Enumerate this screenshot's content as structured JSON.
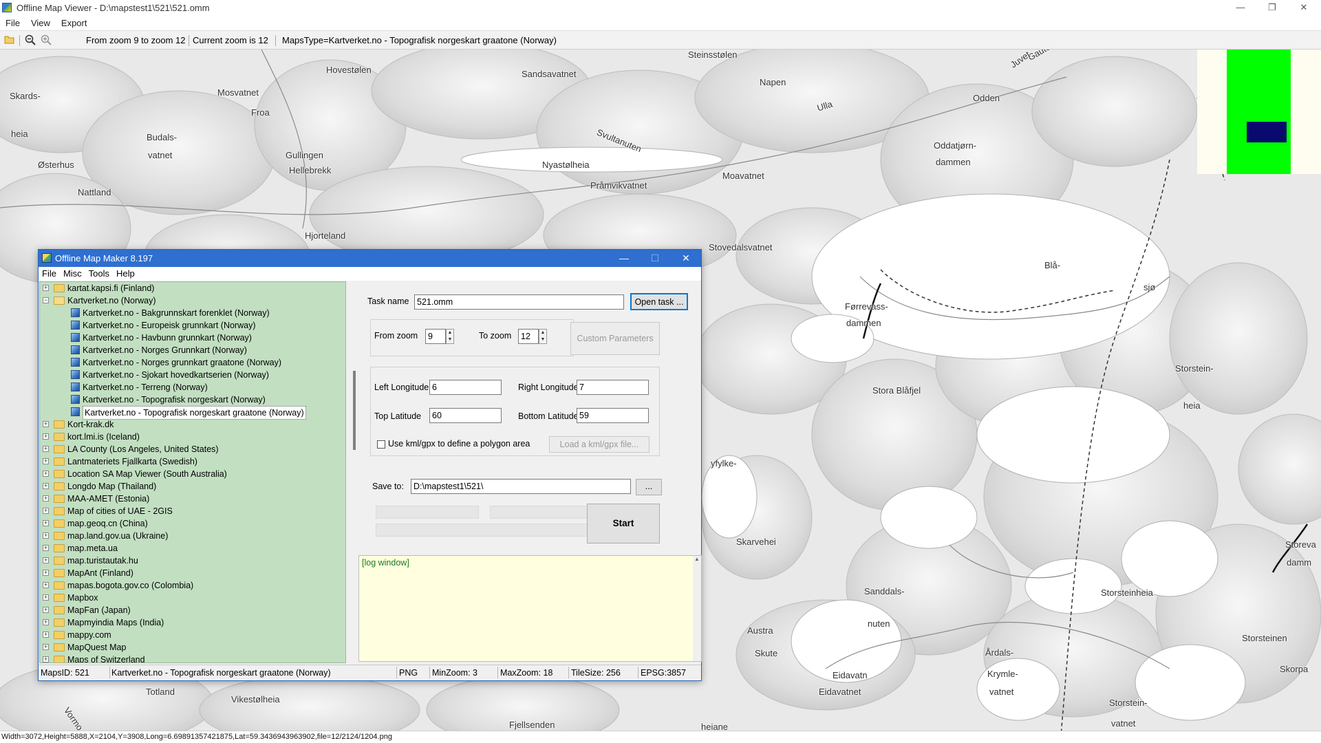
{
  "window": {
    "title": "Offline Map Viewer - D:\\mapstest1\\521\\521.omm",
    "minimize": "—",
    "maximize": "❐",
    "close": "✕"
  },
  "menu": {
    "file": "File",
    "view": "View",
    "export": "Export"
  },
  "toolbar": {
    "open_icon": "folder-open-icon",
    "zoom_out_icon": "zoom-out-icon",
    "zoom_in_icon": "zoom-in-icon",
    "zoom_range": "From zoom 9 to zoom 12",
    "current_zoom": "Current zoom is 12",
    "maps_type": "MapsType=Kartverket.no - Topografisk norgeskart graatone (Norway)"
  },
  "map_labels": [
    {
      "id": "skards",
      "text": "Skards-"
    },
    {
      "id": "heia1",
      "text": "heia"
    },
    {
      "id": "mosvatnet",
      "text": "Mosvatnet"
    },
    {
      "id": "froa",
      "text": "Froa"
    },
    {
      "id": "hovestolen",
      "text": "Hovestølen"
    },
    {
      "id": "sandsavatnet",
      "text": "Sandsavatnet"
    },
    {
      "id": "steinsstolen",
      "text": "Steinsstølen"
    },
    {
      "id": "napen",
      "text": "Napen"
    },
    {
      "id": "gaute",
      "text": "Gaute"
    },
    {
      "id": "juvet",
      "text": "Juvet"
    },
    {
      "id": "odden",
      "text": "Odden"
    },
    {
      "id": "ulla",
      "text": "Ulla"
    },
    {
      "id": "budals",
      "text": "Budals-"
    },
    {
      "id": "vatnet1",
      "text": "vatnet"
    },
    {
      "id": "gullingen",
      "text": "Gullingen"
    },
    {
      "id": "hellebrekk",
      "text": "Hellebrekk"
    },
    {
      "id": "osterhus",
      "text": "Østerhus"
    },
    {
      "id": "sviltanuten",
      "text": "Svultanuten"
    },
    {
      "id": "nyastolheia",
      "text": "Nyastølheia"
    },
    {
      "id": "oddatjorn",
      "text": "Oddatjørn-"
    },
    {
      "id": "dammen1",
      "text": "dammen"
    },
    {
      "id": "moavatnet",
      "text": "Moavatnet"
    },
    {
      "id": "pramvikvatnet",
      "text": "Pråmvikvatnet"
    },
    {
      "id": "nattland",
      "text": "Nattland"
    },
    {
      "id": "hjorteland",
      "text": "Hjorteland"
    },
    {
      "id": "stovedalsvatnet",
      "text": "Stovedalsvatnet"
    },
    {
      "id": "bla",
      "text": "Blå-"
    },
    {
      "id": "sjo",
      "text": "sjø"
    },
    {
      "id": "forrevass",
      "text": "Førrevass-"
    },
    {
      "id": "dammen2",
      "text": "dammen"
    },
    {
      "id": "storstein1",
      "text": "Storstein-"
    },
    {
      "id": "heia2",
      "text": "heia"
    },
    {
      "id": "stora_blafjel",
      "text": "Stora Blåfjel"
    },
    {
      "id": "fylke",
      "text": "yfylke-"
    },
    {
      "id": "skarvehei",
      "text": "Skarvehei"
    },
    {
      "id": "sanddals",
      "text": "Sanddals-"
    },
    {
      "id": "nuten",
      "text": "nuten"
    },
    {
      "id": "storsteinheia",
      "text": "Storsteinheia"
    },
    {
      "id": "storeva",
      "text": "Storeva"
    },
    {
      "id": "damm",
      "text": "damm"
    },
    {
      "id": "austra",
      "text": "Austra"
    },
    {
      "id": "skute",
      "text": "Skute"
    },
    {
      "id": "ardals",
      "text": "Årdals-"
    },
    {
      "id": "krymle",
      "text": "Krymle-"
    },
    {
      "id": "vatnet2",
      "text": "vatnet"
    },
    {
      "id": "storsteinen",
      "text": "Storsteinen"
    },
    {
      "id": "eidavatn",
      "text": "Eidavatn"
    },
    {
      "id": "eidavatnet",
      "text": "Eidavatnet"
    },
    {
      "id": "skorpa",
      "text": "Skorpa"
    },
    {
      "id": "storstein2",
      "text": "Storstein-"
    },
    {
      "id": "vatnet3",
      "text": "vatnet"
    },
    {
      "id": "totland",
      "text": "Totland"
    },
    {
      "id": "vikestolheia",
      "text": "Vikestølheia"
    },
    {
      "id": "vormo",
      "text": "Vormo"
    },
    {
      "id": "fjellsenden",
      "text": "Fjellsenden"
    },
    {
      "id": "heiane",
      "text": "heiane"
    }
  ],
  "status_bar": "Width=3072,Height=5888,X=2104,Y=3908,Long=6.69891357421875,Lat=59.3436943963902,file=12/2124/1204.png",
  "dialog": {
    "title": "Offline Map Maker 8.197",
    "minimize": "—",
    "maximize": "☐",
    "close": "✕",
    "menu": {
      "file": "File",
      "misc": "Misc",
      "tools": "Tools",
      "help": "Help"
    },
    "tree": [
      {
        "level": 0,
        "type": "folder",
        "expander": "+",
        "label": "kartat.kapsi.fi (Finland)"
      },
      {
        "level": 0,
        "type": "folder-open",
        "expander": "−",
        "label": "Kartverket.no (Norway)"
      },
      {
        "level": 1,
        "type": "map",
        "label": "Kartverket.no - Bakgrunnskart forenklet (Norway)"
      },
      {
        "level": 1,
        "type": "map",
        "label": "Kartverket.no - Europeisk grunnkart (Norway)"
      },
      {
        "level": 1,
        "type": "map",
        "label": "Kartverket.no - Havbunn grunnkart (Norway)"
      },
      {
        "level": 1,
        "type": "map",
        "label": "Kartverket.no - Norges Grunnkart (Norway)"
      },
      {
        "level": 1,
        "type": "map",
        "label": "Kartverket.no - Norges grunnkart graatone (Norway)"
      },
      {
        "level": 1,
        "type": "map",
        "label": "Kartverket.no - Sjokart hovedkartserien (Norway)"
      },
      {
        "level": 1,
        "type": "map",
        "label": "Kartverket.no - Terreng (Norway)"
      },
      {
        "level": 1,
        "type": "map",
        "label": "Kartverket.no - Topografisk norgeskart (Norway)"
      },
      {
        "level": 1,
        "type": "map",
        "label": "Kartverket.no - Topografisk norgeskart graatone (Norway)",
        "selected": true
      },
      {
        "level": 0,
        "type": "folder",
        "expander": "+",
        "label": "Kort-krak.dk"
      },
      {
        "level": 0,
        "type": "folder",
        "expander": "+",
        "label": "kort.lmi.is (Iceland)"
      },
      {
        "level": 0,
        "type": "folder",
        "expander": "+",
        "label": "LA County (Los Angeles, United States)"
      },
      {
        "level": 0,
        "type": "folder",
        "expander": "+",
        "label": "Lantmateriets Fjallkarta (Swedish)"
      },
      {
        "level": 0,
        "type": "folder",
        "expander": "+",
        "label": "Location SA Map Viewer (South Australia)"
      },
      {
        "level": 0,
        "type": "folder",
        "expander": "+",
        "label": "Longdo Map (Thailand)"
      },
      {
        "level": 0,
        "type": "folder",
        "expander": "+",
        "label": "MAA-AMET (Estonia)"
      },
      {
        "level": 0,
        "type": "folder",
        "expander": "+",
        "label": "Map of cities of UAE - 2GIS"
      },
      {
        "level": 0,
        "type": "folder",
        "expander": "+",
        "label": "map.geoq.cn (China)"
      },
      {
        "level": 0,
        "type": "folder",
        "expander": "+",
        "label": "map.land.gov.ua (Ukraine)"
      },
      {
        "level": 0,
        "type": "folder",
        "expander": "+",
        "label": "map.meta.ua"
      },
      {
        "level": 0,
        "type": "folder",
        "expander": "+",
        "label": "map.turistautak.hu"
      },
      {
        "level": 0,
        "type": "folder",
        "expander": "+",
        "label": "MapAnt (Finland)"
      },
      {
        "level": 0,
        "type": "folder",
        "expander": "+",
        "label": "mapas.bogota.gov.co (Colombia)"
      },
      {
        "level": 0,
        "type": "folder",
        "expander": "+",
        "label": "Mapbox"
      },
      {
        "level": 0,
        "type": "folder",
        "expander": "+",
        "label": "MapFan (Japan)"
      },
      {
        "level": 0,
        "type": "folder",
        "expander": "+",
        "label": "Mapmyindia Maps (India)"
      },
      {
        "level": 0,
        "type": "folder",
        "expander": "+",
        "label": "mappy.com"
      },
      {
        "level": 0,
        "type": "folder",
        "expander": "+",
        "label": "MapQuest Map"
      },
      {
        "level": 0,
        "type": "folder",
        "expander": "+",
        "label": "Maps of Switzerland"
      }
    ],
    "task_name_label": "Task name",
    "task_name_value": "521.omm",
    "open_task_button": "Open task ...",
    "from_zoom_label": "From zoom",
    "from_zoom_value": "9",
    "to_zoom_label": "To zoom",
    "to_zoom_value": "12",
    "custom_params_button": "Custom Parameters",
    "left_longitude_label": "Left Longitude",
    "left_longitude_value": "6",
    "right_longitude_label": "Right Longitude",
    "right_longitude_value": "7",
    "top_latitude_label": "Top Latitude",
    "top_latitude_value": "60",
    "bottom_latitude_label": "Bottom Latitude",
    "bottom_latitude_value": "59",
    "use_kml_label": "Use kml/gpx to define a polygon area",
    "use_kml_checked": false,
    "load_kml_button": "Load a kml/gpx file...",
    "save_to_label": "Save to:",
    "save_to_value": "D:\\mapstest1\\521\\",
    "browse_button": "...",
    "start_button": "Start",
    "log_text": "[log window]",
    "status": {
      "maps_id": "MapsID: 521",
      "maps_name": "Kartverket.no - Topografisk norgeskart graatone (Norway)",
      "format": "PNG",
      "min_zoom": "MinZoom: 3",
      "max_zoom": "MaxZoom: 18",
      "tile_size": "TileSize: 256",
      "epsg": "EPSG:3857"
    }
  }
}
